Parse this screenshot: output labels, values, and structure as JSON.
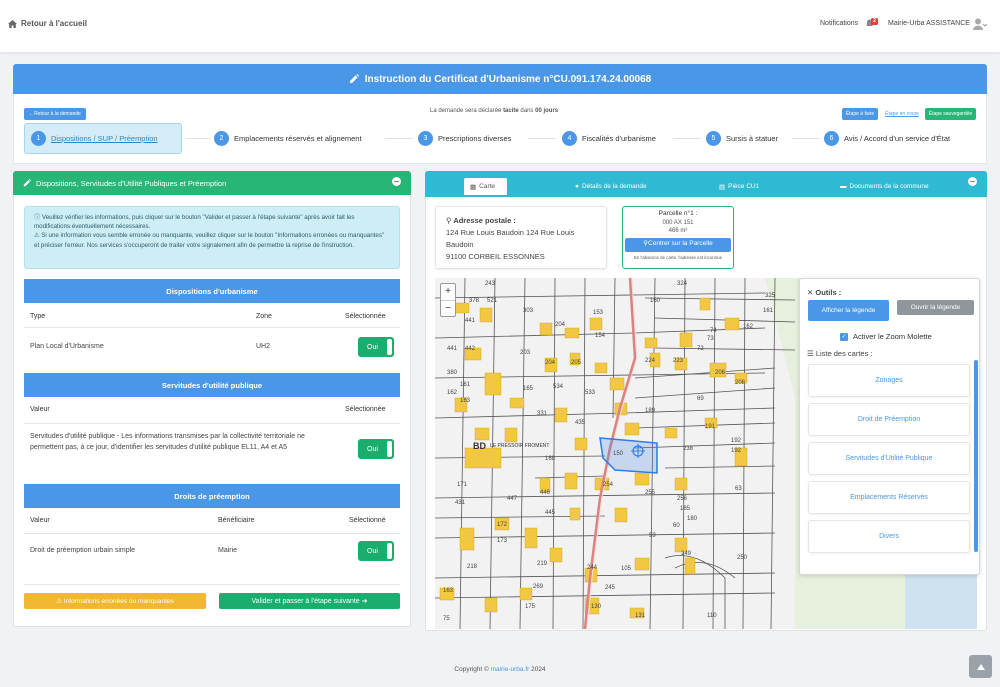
{
  "header": {
    "home_label": "Retour à l'accueil",
    "notifications_label": "Notifications",
    "notifications_count": "2",
    "user_name": "Mairie-Urba ASSISTANCE"
  },
  "title": "Instruction du Certificat d'Urbanisme n°CU.091.174.24.00068",
  "toolbar": {
    "back_label": "Retour à la demande",
    "declaration_prefix": "La demande sera déclarée",
    "declaration_type": "tacite",
    "declaration_middle": "dans",
    "declaration_days": "00 jours",
    "btn_todo": "Étape à faire",
    "btn_inprogress": "Étape en cours",
    "btn_saved": "Étape sauvegardée"
  },
  "steps": [
    {
      "num": "1",
      "label": "Dispositions / SUP / Préemption"
    },
    {
      "num": "2",
      "label": "Emplacements réservés et alignement"
    },
    {
      "num": "3",
      "label": "Prescriptions diverses"
    },
    {
      "num": "4",
      "label": "Fiscalités d'urbanisme"
    },
    {
      "num": "5",
      "label": "Sursis à statuer"
    },
    {
      "num": "6",
      "label": "Avis / Accord d'un service d'État"
    }
  ],
  "left": {
    "heading": "Dispositions, Servitudes d'Utilité Publiques et Préemption",
    "info_1": "Veuillez vérifier les informations, puis cliquer sur le bouton \"Valider et passer à l'étape suivante\" après avoir fait les modifications éventuellement nécessaires.",
    "info_2": "Si une information vous semble erronée ou manquante, veuillez cliquer sur le bouton \"Informations erronées ou manquantes\" et préciser l'erreur. Nos services s'occuperont de traiter votre signalement afin de permettre la reprise de l'instruction.",
    "dispositions": {
      "title": "Dispositions d'urbanisme",
      "col_type": "Type",
      "col_zone": "Zone",
      "col_selected": "Sélectionnée",
      "row_type": "Plan Local d'Urbanisme",
      "row_zone": "UH2",
      "row_toggle": "Oui"
    },
    "servitudes": {
      "title": "Servitudes d'utilité publique",
      "col_value": "Valeur",
      "col_selected": "Sélectionnée",
      "row_value": "Servitudes d'utilité publique - Les informations transmises par la collectivité territoriale ne permettent pas, à ce jour, d'identifier les servitudes d'utilité publique EL11, A4 et A5",
      "row_toggle": "Oui"
    },
    "preemption": {
      "title": "Droits de préemption",
      "col_value": "Valeur",
      "col_benef": "Bénéficiaire",
      "col_selected": "Sélectionné",
      "row_value": "Droit de préemption urbain simple",
      "row_benef": "Mairie",
      "row_toggle": "Oui"
    },
    "btn_error": "Informations erronées ou manquantes",
    "btn_validate": "Valider et passer à l'étape suivante"
  },
  "right": {
    "tabs": [
      "Carte",
      "Détails de la demande",
      "Pièce CU1",
      "Documents de la commune"
    ],
    "address_label": "Adresse postale :",
    "address_line1": "124 Rue Louis Baudoin 124 Rue Louis Baudoin",
    "address_line2": "91100 CORBEIL ESSONNES",
    "parcel_label": "Parcelle n°1 :",
    "parcel_id": "000 AX 151",
    "parcel_area": "466 m²",
    "parcel_btn": "Centrer sur la Parcelle",
    "parcel_note": "En l'absence de carte, l'adresse est inconnue",
    "tools_label": "Outils :",
    "legend_show": "Afficher la légende",
    "legend_open": "Ouvrir la légende",
    "zoom_label": "Activer le Zoom Molette",
    "maps_label": "Liste des cartes :",
    "maps": [
      "Zonages",
      "Droit de Préemption",
      "Servitudes d'Utilité Publique",
      "Emplacements Réservés",
      "Divers"
    ],
    "zoom_in": "+",
    "zoom_out": "−",
    "map_labels": {
      "bd": "BD",
      "street": "LE PRESSOIR FROMENT",
      "nums": [
        "243",
        "324",
        "325",
        "378",
        "521",
        "160",
        "161",
        "441",
        "303",
        "153",
        "162",
        "204",
        "74",
        "73",
        "72",
        "154",
        "441",
        "442",
        "203",
        "204",
        "205",
        "224",
        "223",
        "206",
        "208",
        "380",
        "161",
        "165",
        "534",
        "533",
        "69",
        "162",
        "163",
        "331",
        "189",
        "191",
        "192",
        "192",
        "168",
        "435",
        "150",
        "238",
        "171",
        "254",
        "255",
        "63",
        "431",
        "447",
        "446",
        "256",
        "185",
        "445",
        "180",
        "60",
        "172",
        "59",
        "173",
        "219",
        "249",
        "250",
        "218",
        "244",
        "105",
        "269",
        "245",
        "163",
        "175",
        "130",
        "131",
        "110",
        "75"
      ]
    }
  },
  "footer": {
    "prefix": "Copyright ©",
    "link": "mairie-urba.fr",
    "year": "2024"
  },
  "colors": {
    "primary": "#4a97e8",
    "success": "#27b675",
    "info": "#2fb9d3",
    "warning": "#f1b732"
  }
}
